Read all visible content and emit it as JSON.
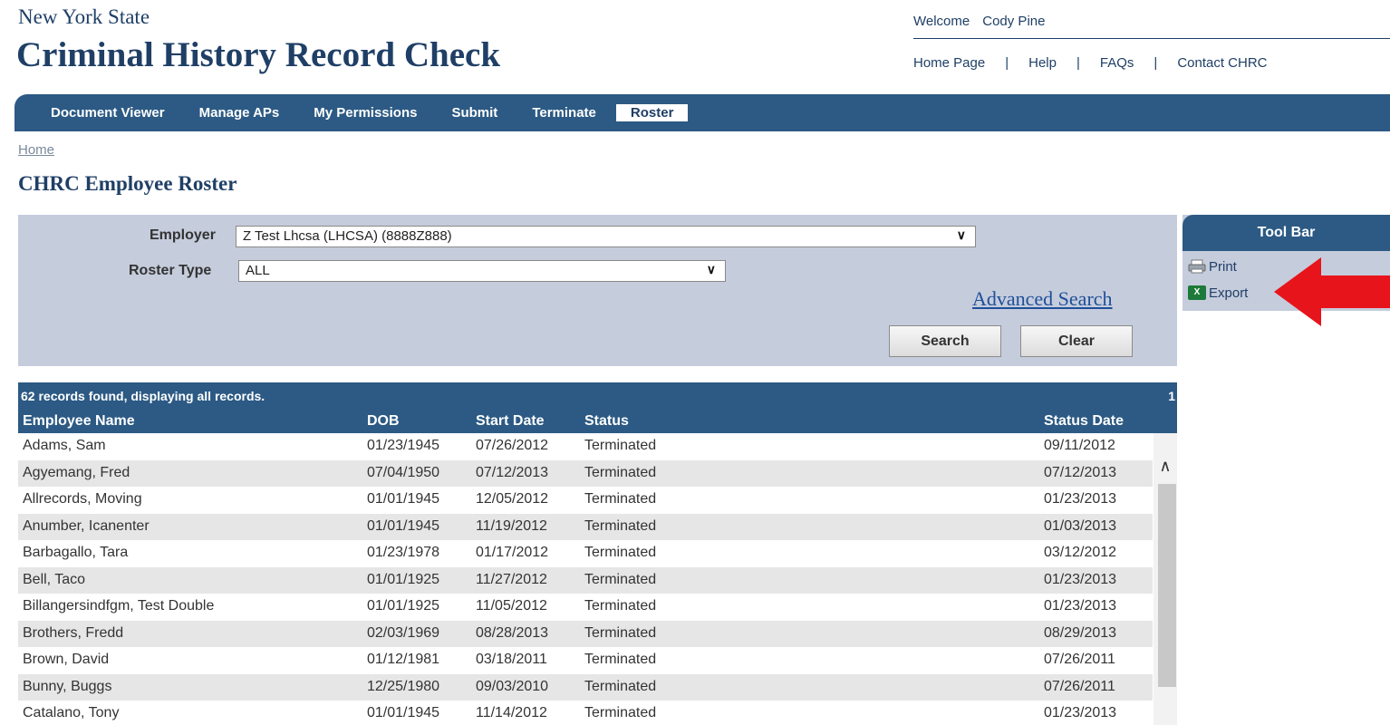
{
  "header": {
    "state": "New York State",
    "app_title": "Criminal History Record Check",
    "welcome_label": "Welcome",
    "user_name": "Cody Pine",
    "links": [
      "Home Page",
      "Help",
      "FAQs",
      "Contact CHRC"
    ],
    "separator": "|"
  },
  "nav": {
    "items": [
      "Document Viewer",
      "Manage APs",
      "My Permissions",
      "Submit",
      "Terminate",
      "Roster"
    ],
    "active": "Roster"
  },
  "breadcrumb": "Home",
  "page_title": "CHRC Employee Roster",
  "search": {
    "employer_label": "Employer",
    "employer_value": "Z Test Lhcsa (LHCSA) (8888Z888)",
    "roster_type_label": "Roster Type",
    "roster_type_value": "ALL",
    "advanced_search": "Advanced Search",
    "search_button": "Search",
    "clear_button": "Clear"
  },
  "toolbar": {
    "title": "Tool Bar",
    "print": "Print",
    "export": "Export",
    "xls_icon_text": "X",
    "arrow_color": "#e8141b"
  },
  "results": {
    "summary": "62 records found, displaying all records.",
    "page": "1",
    "columns": [
      "Employee Name",
      "DOB",
      "Start Date",
      "Status",
      "Status Date"
    ],
    "rows": [
      [
        "Adams, Sam",
        "01/23/1945",
        "07/26/2012",
        "Terminated",
        "09/11/2012"
      ],
      [
        "Agyemang, Fred",
        "07/04/1950",
        "07/12/2013",
        "Terminated",
        "07/12/2013"
      ],
      [
        "Allrecords, Moving",
        "01/01/1945",
        "12/05/2012",
        "Terminated",
        "01/23/2013"
      ],
      [
        "Anumber, Icanenter",
        "01/01/1945",
        "11/19/2012",
        "Terminated",
        "01/03/2013"
      ],
      [
        "Barbagallo, Tara",
        "01/23/1978",
        "01/17/2012",
        "Terminated",
        "03/12/2012"
      ],
      [
        "Bell, Taco",
        "01/01/1925",
        "11/27/2012",
        "Terminated",
        "01/23/2013"
      ],
      [
        "Billangersindfgm, Test Double",
        "01/01/1925",
        "11/05/2012",
        "Terminated",
        "01/23/2013"
      ],
      [
        "Brothers, Fredd",
        "02/03/1969",
        "08/28/2013",
        "Terminated",
        "08/29/2013"
      ],
      [
        "Brown, David",
        "01/12/1981",
        "03/18/2011",
        "Terminated",
        "07/26/2011"
      ],
      [
        "Bunny, Buggs",
        "12/25/1980",
        "09/03/2010",
        "Terminated",
        "07/26/2011"
      ],
      [
        "Catalano, Tony",
        "01/01/1945",
        "11/14/2012",
        "Terminated",
        "01/23/2013"
      ]
    ]
  },
  "colors": {
    "brand_blue": "#2c5a84",
    "panel": "#c5ccdc",
    "row_alt": "#e6e6e6"
  }
}
